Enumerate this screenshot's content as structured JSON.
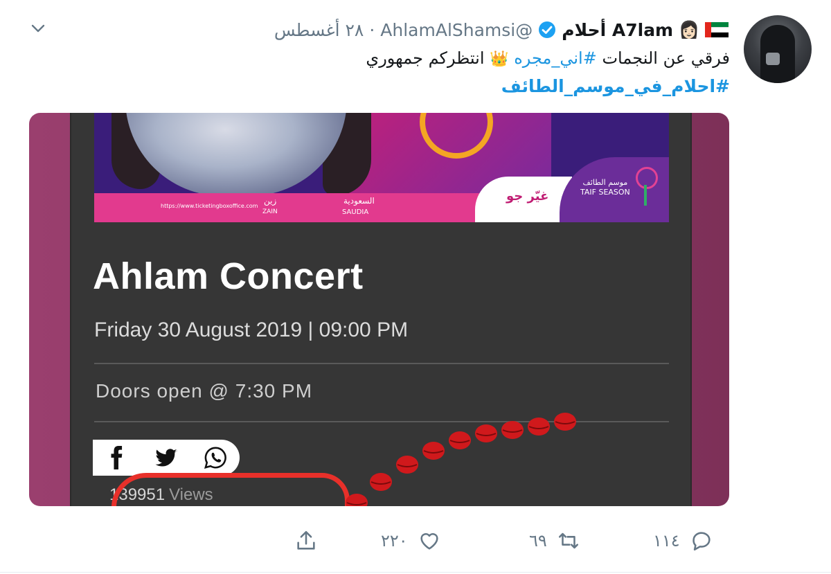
{
  "tweet": {
    "author_name": "A7lam أحلام",
    "handle": "@AhlamAlShamsi",
    "separator": "·",
    "date": "٢٨ أغسطس",
    "text_line1_a": "فرقي عن النجمات",
    "hashtag1": "#اني_مجره",
    "text_line1_b": "انتظركم جمهوري",
    "hashtag2": "#احلام_في_موسم_الطائف",
    "icons": [
      "chevron-down-icon",
      "uae-flag-icon",
      "face-emoji-icon",
      "verified-badge-icon",
      "crown-emoji-icon"
    ]
  },
  "media": {
    "banner": {
      "brand_badge": "غيّر جو",
      "taif_ar": "موسم الطائف",
      "taif_en": "TAIF SEASON",
      "sponsor_saudia_ar": "السعودية",
      "sponsor_saudia_en": "SAUDIA",
      "sponsor_zain_ar": "زين",
      "sponsor_zain_en": "ZAIN",
      "sponsor_url": "https://www.ticketingboxoffice.com"
    },
    "concert_title": "Ahlam Concert",
    "concert_date": "Friday 30 August 2019 | 09:00 PM",
    "doors": "Doors open @ 7:30 PM",
    "share_icons": [
      "facebook-icon",
      "twitter-icon",
      "whatsapp-icon"
    ],
    "views_count": "139951",
    "views_label": "Views"
  },
  "actions": {
    "reply_count": "١١٤",
    "retweet_count": "٦٩",
    "like_count": "٢٢٠",
    "icons": [
      "reply-icon",
      "retweet-icon",
      "like-icon",
      "share-icon"
    ]
  },
  "colors": {
    "link": "#1b95e0",
    "muted": "#657786",
    "media_bg": "#363636",
    "accent_red": "#e8302a"
  }
}
